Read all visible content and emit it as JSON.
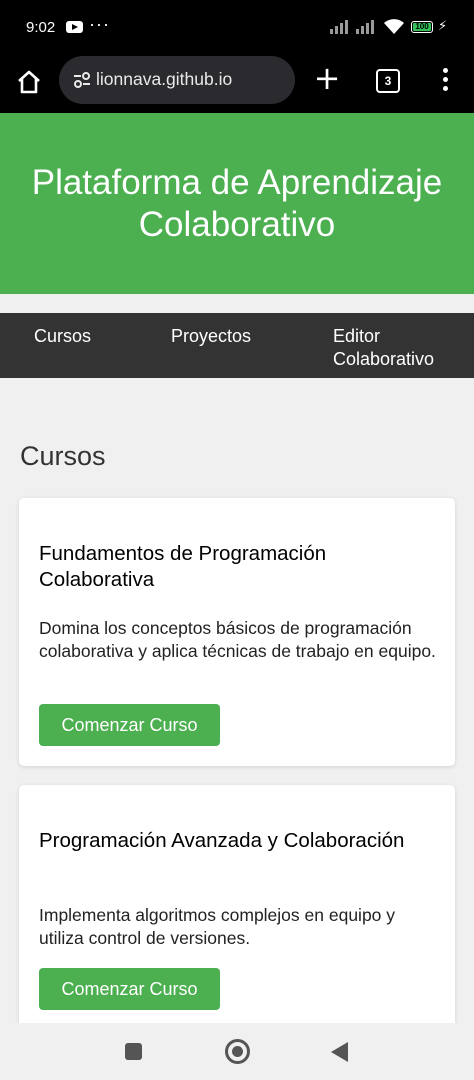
{
  "status_bar": {
    "time": "9:02",
    "battery": "100",
    "icons": [
      "youtube-icon",
      "more-dots-icon",
      "signal-icon",
      "signal-icon",
      "wifi-icon",
      "battery-icon",
      "charging-icon"
    ]
  },
  "browser": {
    "url": "lionnava.github.io",
    "tab_count": "3",
    "icons": [
      "home-icon",
      "site-settings-icon",
      "new-tab-plus-icon",
      "tab-switcher-icon",
      "overflow-menu-icon"
    ]
  },
  "header": {
    "title": "Plataforma de Aprendizaje Colaborativo",
    "background": "#4caf50"
  },
  "nav": {
    "items": [
      {
        "label": "Cursos"
      },
      {
        "label": "Proyectos"
      },
      {
        "label": "Editor Colaborativo"
      }
    ],
    "background": "#333333"
  },
  "main": {
    "section_title": "Cursos",
    "courses": [
      {
        "title": "Fundamentos de Programación Colaborativa",
        "description": "Domina los conceptos básicos de programación colaborativa y aplica técnicas de trabajo en equipo.",
        "button": "Comenzar Curso"
      },
      {
        "title": "Programación Avanzada y Colaboración",
        "description": "Implementa algoritmos complejos en equipo y utiliza control de versiones.",
        "button": "Comenzar Curso"
      }
    ]
  },
  "system_nav": {
    "icons": [
      "recents-square-icon",
      "home-circle-icon",
      "back-triangle-icon"
    ]
  }
}
